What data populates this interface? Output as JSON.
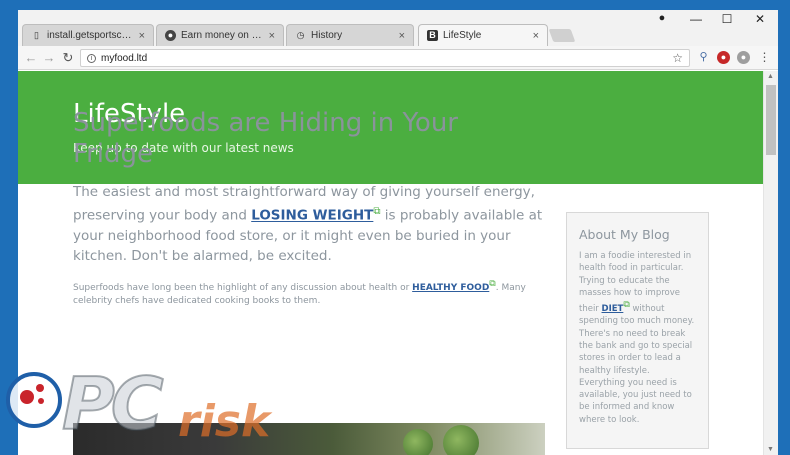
{
  "browser": {
    "tabs": [
      {
        "label": "install.getsportscore.com",
        "icon": "page-icon"
      },
      {
        "label": "Earn money on short lin",
        "icon": "site-favicon"
      },
      {
        "label": "History",
        "icon": "history-icon"
      },
      {
        "label": "LifeStyle",
        "icon": "b-favicon"
      }
    ],
    "tab_close": "×",
    "address": "myfood.ltd",
    "window_controls": {
      "minimize": "—",
      "maximize": "☐",
      "close": "✕"
    }
  },
  "page": {
    "site_title": "LifeStyle",
    "site_tagline": "Keep up to date with our latest news",
    "article": {
      "title": "Superfoods are Hiding in Your Fridge",
      "lead_part1": "The easiest and most straightforward way of giving yourself energy, preserving your body and ",
      "lead_link": "LOSING WEIGHT",
      "lead_part2": " is probably available at your neighborhood food store, or it might even be buried in your kitchen. Don't be alarmed, be excited.",
      "body_part1": "Superfoods have long been the highlight of any discussion about health or ",
      "body_link": "HEALTHY FOOD",
      "body_part2": ". Many celebrity chefs have dedicated cooking books to them."
    },
    "sidebar": {
      "title": "About My Blog",
      "text_part1": "I am a foodie interested in health food in particular. Trying to educate the masses how to improve their ",
      "text_link": "DIET",
      "text_part2": " without spending too much money. There's no need to break the bank and go to special stores in order to lead a healthy lifestyle. Everything you need is available, you just need to be informed and know where to look."
    }
  },
  "watermark": {
    "brand_left": "PC",
    "brand_right": "risk"
  },
  "colors": {
    "hero_green": "#4bae40",
    "link_blue": "#2e5d9c",
    "desktop_blue": "#1e6fb8"
  }
}
